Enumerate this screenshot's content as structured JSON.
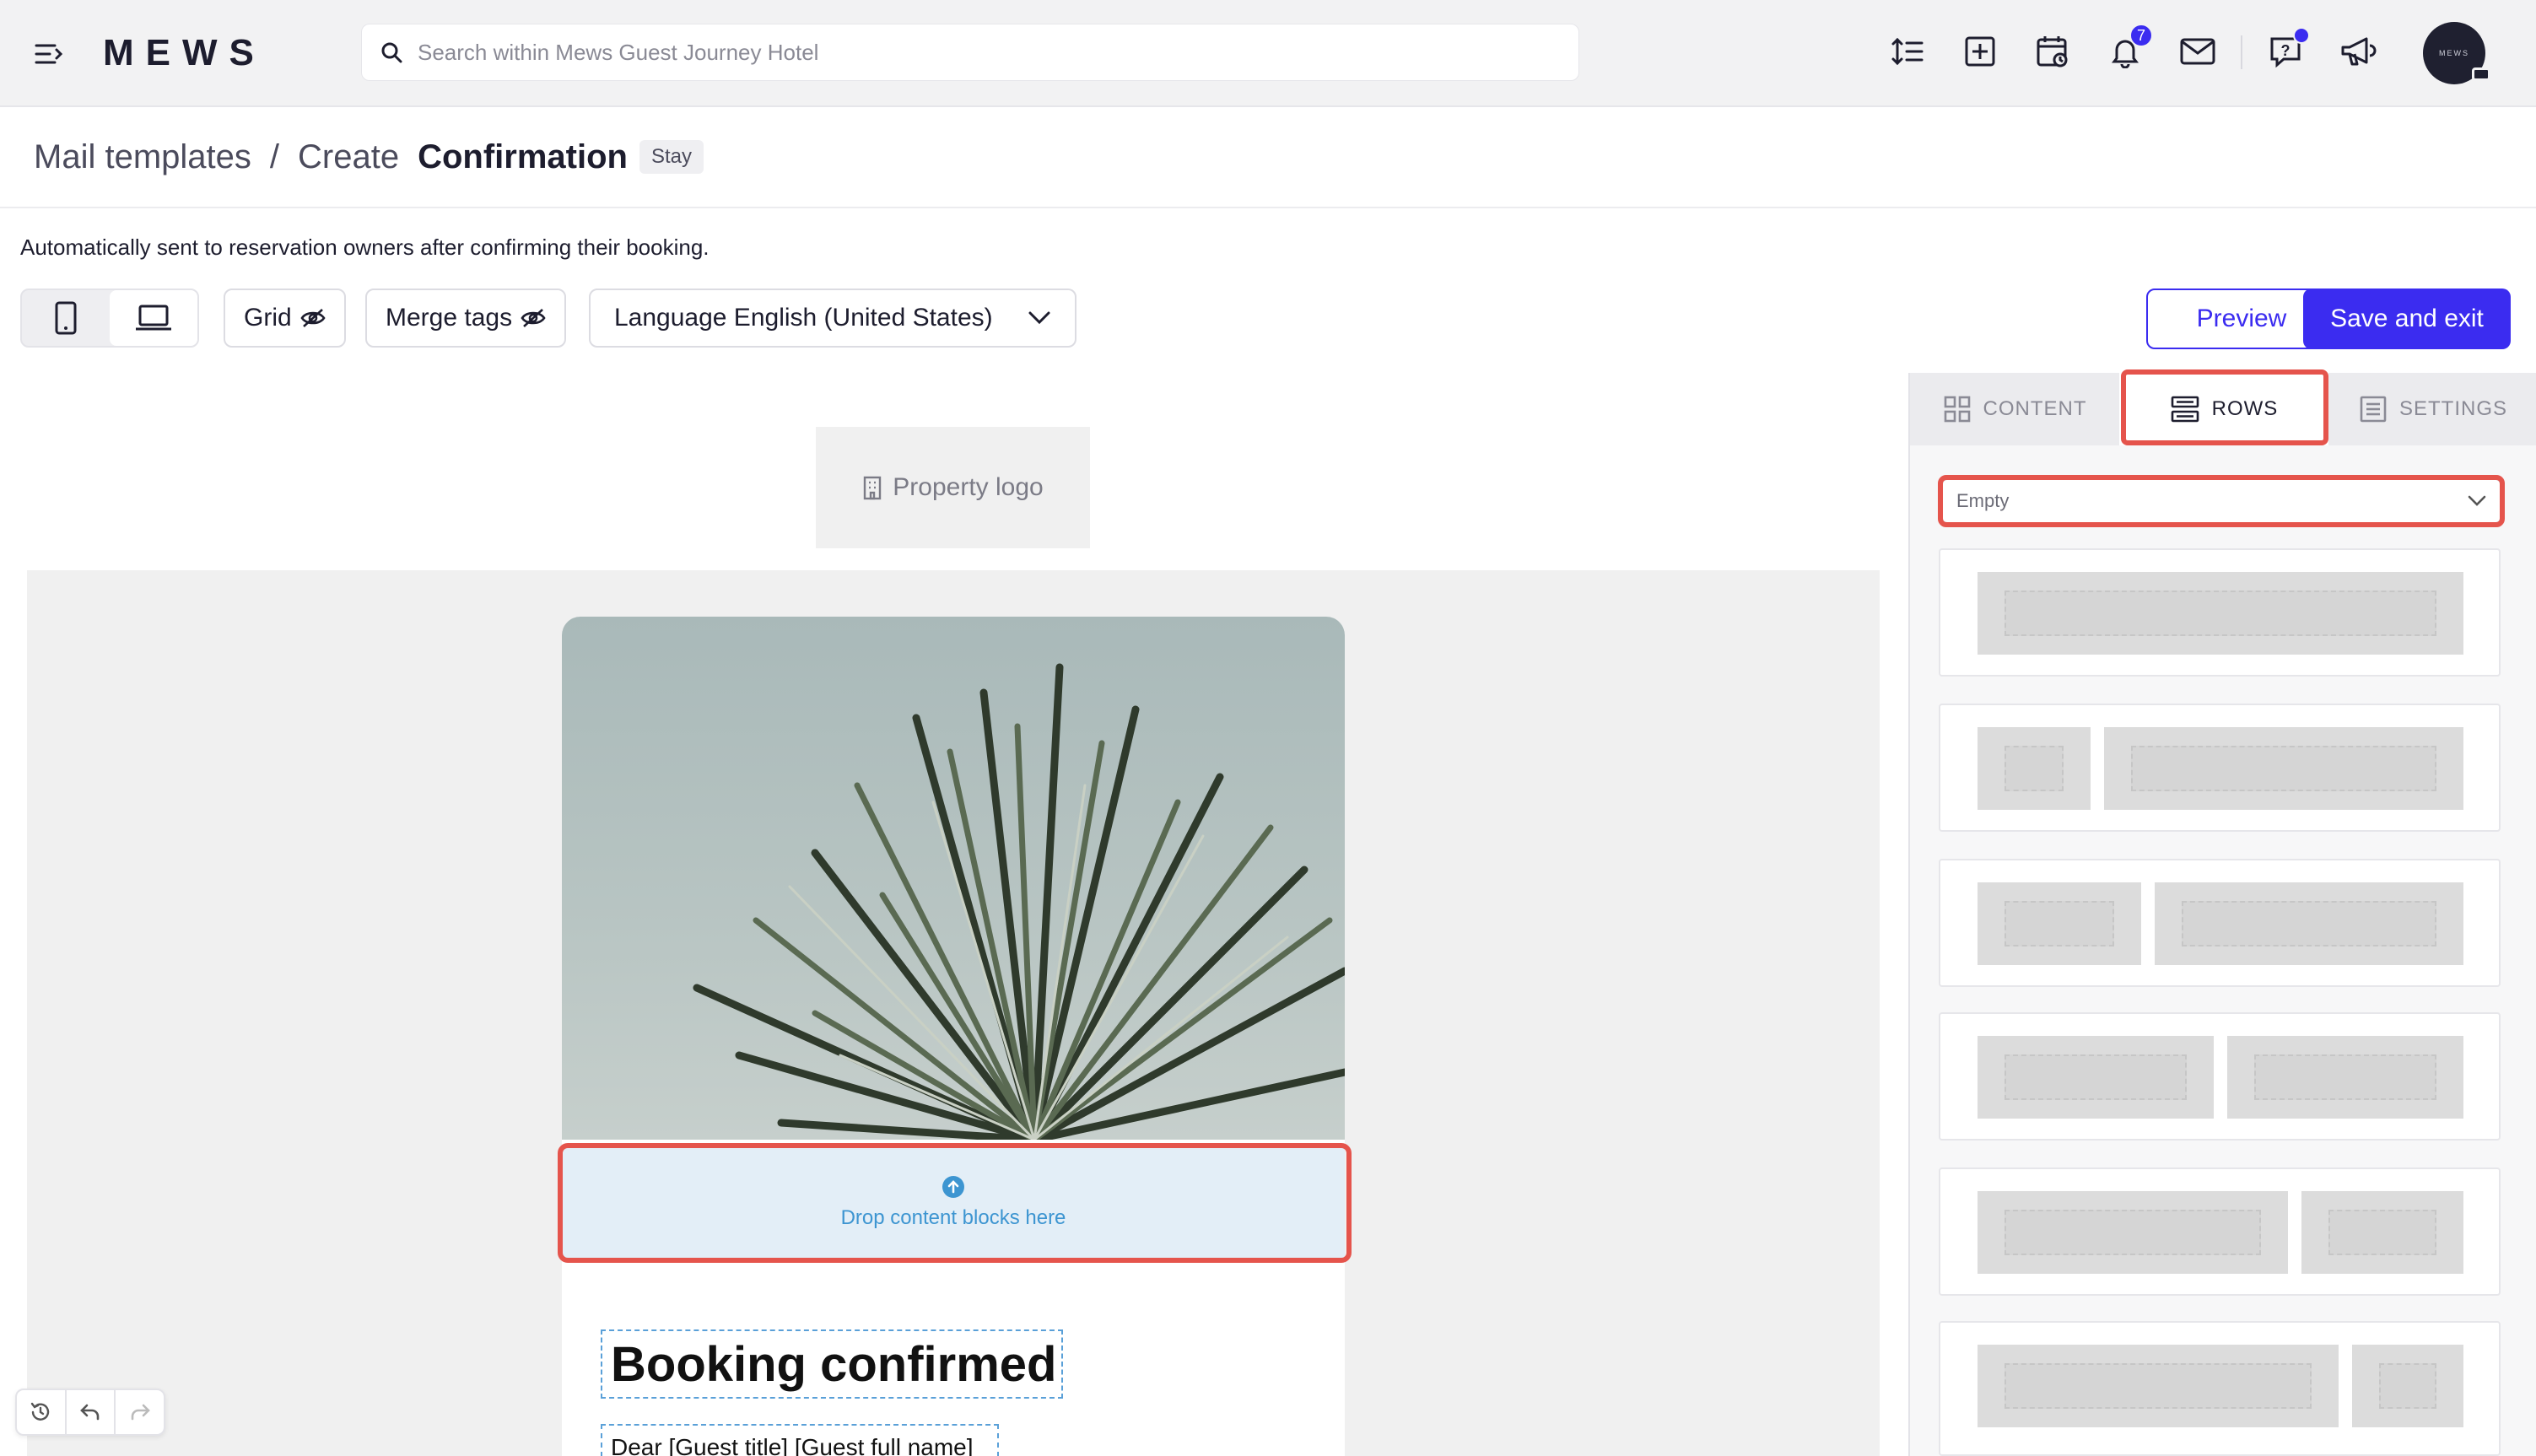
{
  "topbar": {
    "brand": "MEWS",
    "search_placeholder": "Search within Mews Guest Journey Hotel",
    "notification_count": "7",
    "avatar_text": "MEWS"
  },
  "breadcrumb": {
    "item1": "Mail templates",
    "sep": "/",
    "item2": "Create",
    "current": "Confirmation",
    "tag": "Stay"
  },
  "description": "Automatically sent to reservation owners after confirming their booking.",
  "toolbar": {
    "grid_label": "Grid",
    "merge_tags_label": "Merge tags",
    "language_label": "Language English (United States)",
    "preview_label": "Preview",
    "save_label": "Save and exit"
  },
  "canvas": {
    "property_logo": "Property logo",
    "drop_text": "Drop content blocks here",
    "heading": "Booking confirmed",
    "greeting": "Dear [Guest title] [Guest full name]"
  },
  "panel": {
    "tabs": [
      {
        "label": "CONTENT",
        "active": false
      },
      {
        "label": "ROWS",
        "active": true
      },
      {
        "label": "SETTINGS",
        "active": false
      }
    ],
    "row_filter": "Empty"
  },
  "colors": {
    "accent": "#3b2cf0",
    "highlight": "#e5544c",
    "dropzone": "#e3eef7"
  }
}
